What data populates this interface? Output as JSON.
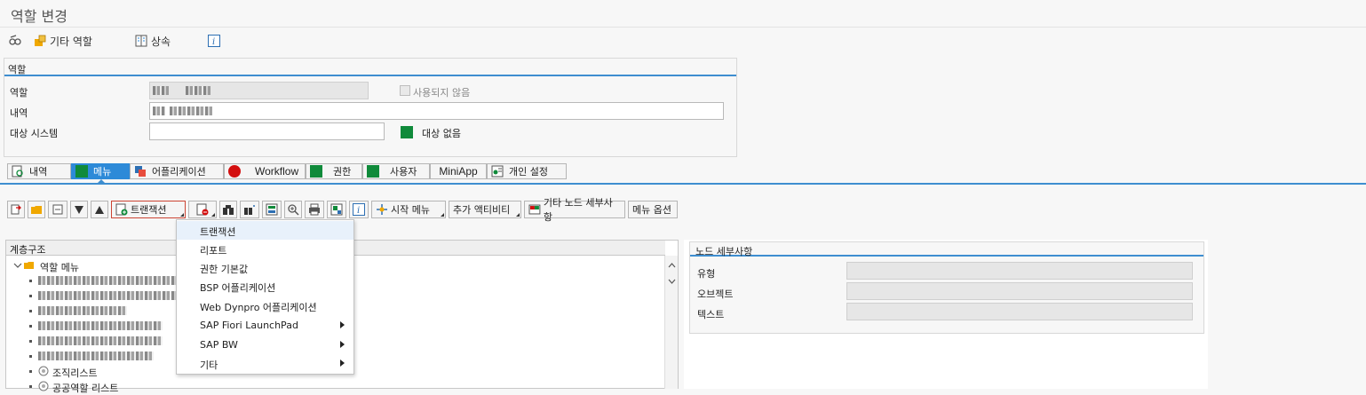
{
  "title": "역할 변경",
  "toolbar": {
    "other_role": "기타 역할",
    "inherit": "상속"
  },
  "role_frame": {
    "heading": "역할",
    "role_label": "역할",
    "desc_label": "내역",
    "target_label": "대상 시스템",
    "unused_label": "사용되지 않음",
    "no_target_label": "대상 없음"
  },
  "tabs": [
    {
      "label": "내역"
    },
    {
      "label": "메뉴"
    },
    {
      "label": "어플리케이션"
    },
    {
      "label": "Workflow"
    },
    {
      "label": "권한"
    },
    {
      "label": "사용자"
    },
    {
      "label": "MiniApp"
    },
    {
      "label": "개인 설정"
    }
  ],
  "menu_toolbar": {
    "transaction": "트랜잭션",
    "start_menu": "시작 메뉴",
    "more_activities": "추가 액티비티",
    "other_node_details": "기타 노드 세부사항",
    "menu_options": "메뉴 옵션"
  },
  "hierarchy": {
    "heading": "계층구조",
    "root": "역할 메뉴",
    "item_org_list": "조직리스트",
    "item_common_list": "공공역할 리스트"
  },
  "node_details": {
    "heading": "노드 세부사항",
    "type_label": "유형",
    "object_label": "오브젝트",
    "text_label": "텍스트"
  },
  "dropdown": {
    "items": [
      {
        "label": "트랜잭션"
      },
      {
        "label": "리포트"
      },
      {
        "label": "권한 기본값"
      },
      {
        "label": "BSP 어플리케이션"
      },
      {
        "label": "Web Dynpro 어플리케이션"
      },
      {
        "label": "SAP Fiori LaunchPad"
      },
      {
        "label": "SAP BW"
      },
      {
        "label": "기타"
      }
    ]
  },
  "colors": {
    "accent": "#3e8ed0",
    "active_tab": "#2d8ad8",
    "green": "#0f8a3a",
    "red": "#d30f0f"
  }
}
